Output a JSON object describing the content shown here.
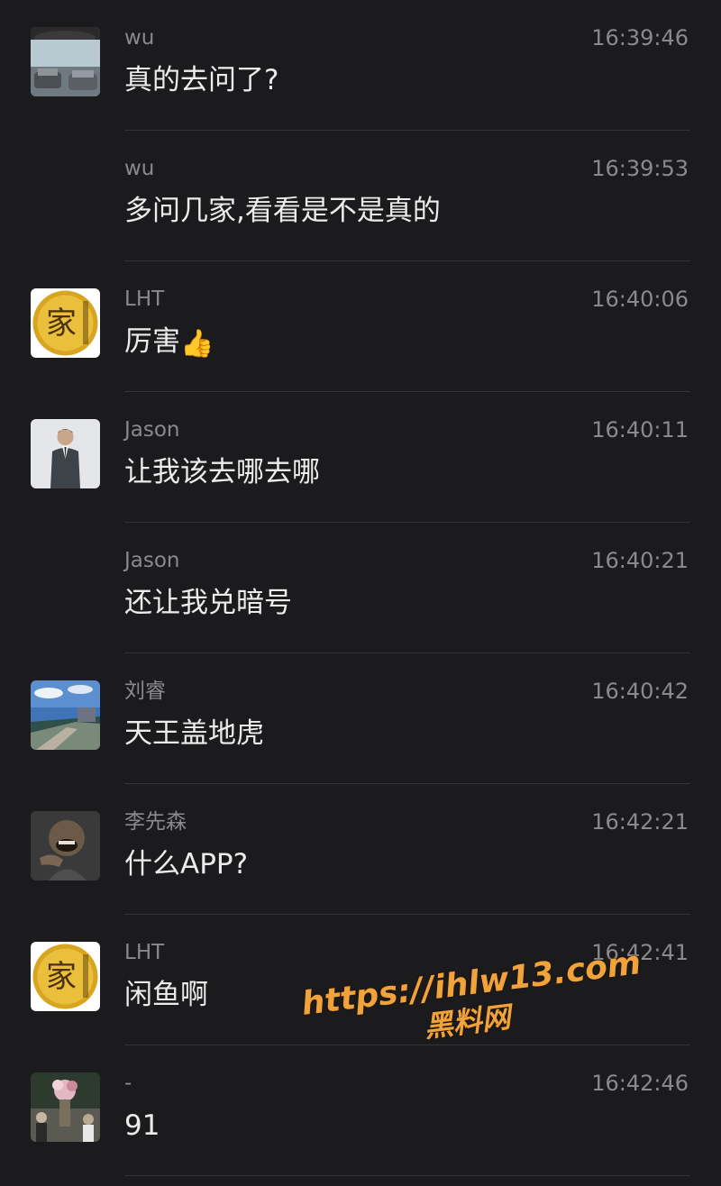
{
  "messages": [
    {
      "sender": "wu",
      "time": "16:39:46",
      "text": "真的去问了?",
      "avatar": "car-photo-avatar"
    },
    {
      "sender": "wu",
      "time": "16:39:53",
      "text": "多问几家,看看是不是真的",
      "avatar": null
    },
    {
      "sender": "LHT",
      "time": "16:40:06",
      "text": "厉害",
      "emoji": "👍",
      "avatar": "gold-coin-avatar"
    },
    {
      "sender": "Jason",
      "time": "16:40:11",
      "text": "让我该去哪去哪",
      "avatar": "suit-man-avatar"
    },
    {
      "sender": "Jason",
      "time": "16:40:21",
      "text": "还让我兑暗号",
      "avatar": null
    },
    {
      "sender": "刘睿",
      "time": "16:40:42",
      "text": "天王盖地虎",
      "avatar": "coast-landscape-avatar"
    },
    {
      "sender": "李先森",
      "time": "16:42:21",
      "text": "什么APP?",
      "avatar": "laughing-man-avatar"
    },
    {
      "sender": "LHT",
      "time": "16:42:41",
      "text": "闲鱼啊",
      "avatar": "gold-coin-avatar"
    },
    {
      "sender": "-",
      "time": "16:42:46",
      "text": "91",
      "avatar": "crowd-photo-avatar"
    }
  ],
  "watermark": {
    "url": "https://ihlw13.com",
    "label": "黑料网"
  },
  "avatar_glyphs": {
    "coin": "家"
  },
  "colors": {
    "background": "#1b1b1d",
    "secondary_text": "#8a8a8d",
    "primary_text": "#ececec",
    "divider": "#343437",
    "watermark": "#f0a33a"
  }
}
